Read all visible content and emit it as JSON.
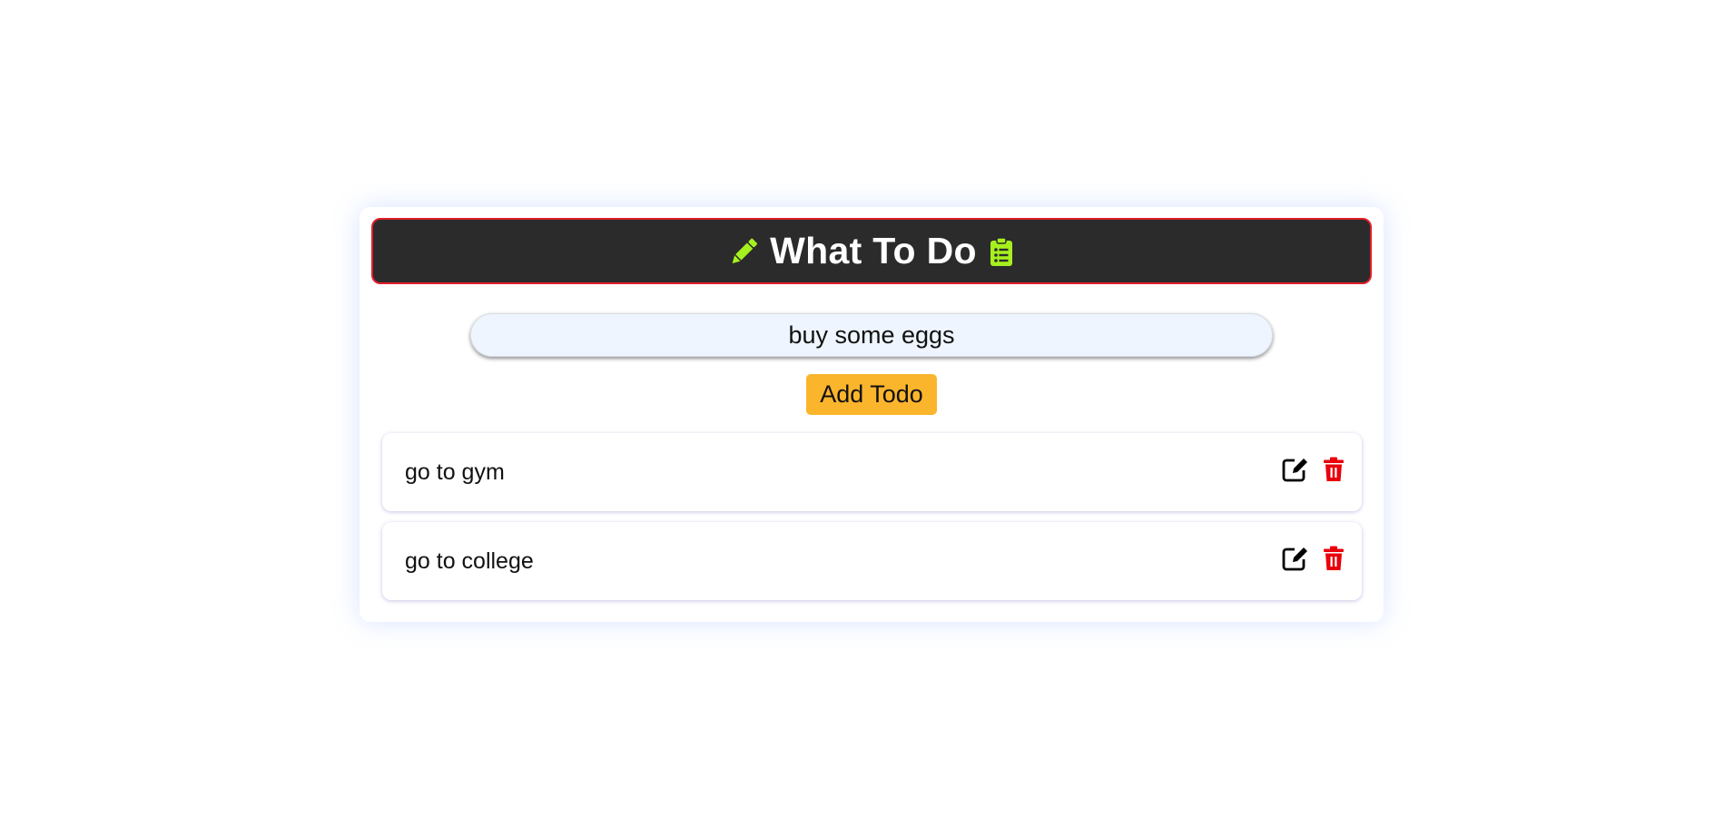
{
  "header": {
    "title": "What To Do",
    "left_icon": "pencil-icon",
    "right_icon": "clipboard-list-icon",
    "icon_color": "#a6f01f",
    "background": "#2b2b2b",
    "border_color": "#e0202a"
  },
  "input": {
    "value": "buy some eggs",
    "placeholder": ""
  },
  "add_button": {
    "label": "Add Todo",
    "color": "#fbb52d"
  },
  "todos": [
    {
      "text": "go to gym",
      "edit_icon": "edit-icon",
      "delete_icon": "trash-icon"
    },
    {
      "text": "go to college",
      "edit_icon": "edit-icon",
      "delete_icon": "trash-icon"
    }
  ],
  "colors": {
    "edit_icon": "#000000",
    "delete_icon": "#e8000b"
  }
}
